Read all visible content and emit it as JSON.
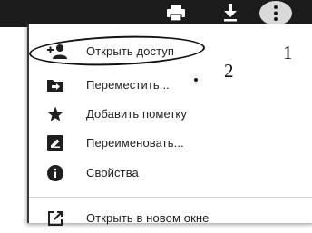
{
  "menu": {
    "items": [
      {
        "label": "Открыть доступ",
        "icon": "add-person-icon"
      },
      {
        "label": "Переместить...",
        "icon": "move-to-folder-icon"
      },
      {
        "label": "Добавить пометку",
        "icon": "star-icon"
      },
      {
        "label": "Переименовать...",
        "icon": "rename-edit-icon"
      },
      {
        "label": "Свойства",
        "icon": "info-icon"
      },
      {
        "label": "Открыть в новом окне",
        "icon": "open-in-new-window-icon"
      }
    ]
  },
  "toolbar": {
    "icons": [
      "print-icon",
      "download-icon",
      "more-vert-icon"
    ]
  },
  "annotations": {
    "label_1": "1",
    "label_2": "2"
  },
  "colors": {
    "toolbar_bg": "#1c1c1c",
    "menu_bg": "#ffffff",
    "icon": "#1f1f1f",
    "text": "#202020"
  }
}
